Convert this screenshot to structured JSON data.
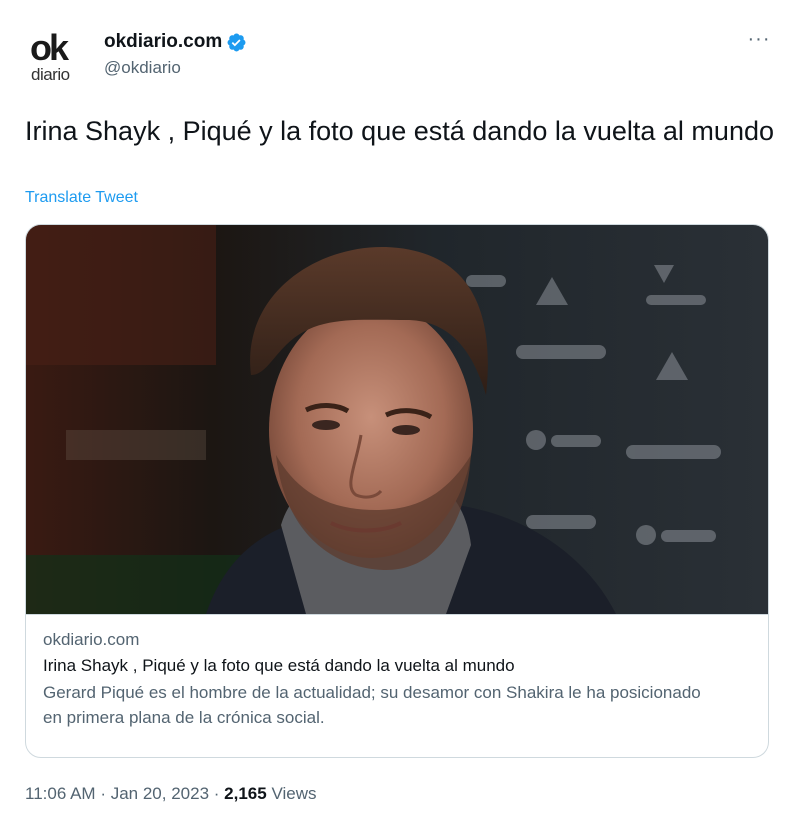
{
  "author": {
    "avatar_text_top": "ok",
    "avatar_text_bottom": "diario",
    "name": "okdiario.com",
    "handle": "@okdiario",
    "verified": true
  },
  "more_label": "···",
  "tweet": {
    "text": "Irina Shayk , Piqué y la foto que está dando la vuelta al mundo",
    "translate_label": "Translate Tweet"
  },
  "card": {
    "image_description": "photo-portrait",
    "domain": "okdiario.com",
    "title": "Irina Shayk , Piqué y la foto que está dando la vuelta al mundo",
    "description": "Gerard Piqué es el hombre de la actualidad; su desamor con Shakira le ha posicionado en primera plana de la crónica social."
  },
  "meta": {
    "time": "11:06 AM",
    "separator": "·",
    "date": "Jan 20, 2023",
    "views_count": "2,165",
    "views_label": "Views"
  },
  "colors": {
    "accent": "#1d9bf0",
    "text_primary": "#0f1419",
    "text_secondary": "#536471",
    "border": "#cfd9de"
  }
}
